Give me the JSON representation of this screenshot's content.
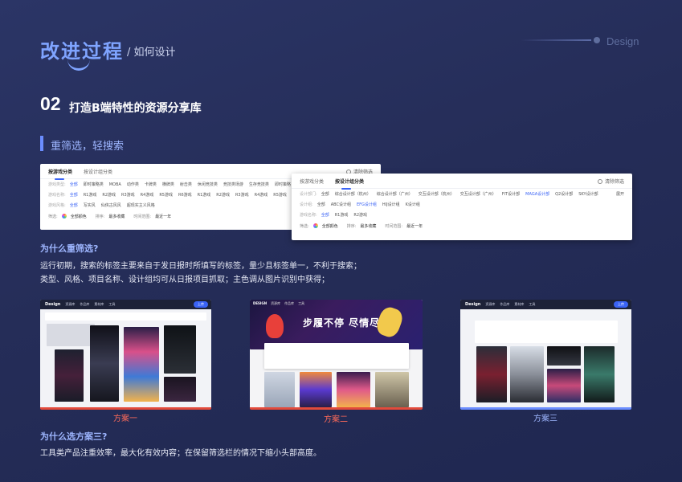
{
  "header": {
    "title": "改进过程",
    "subtitle": "/ 如何设计",
    "brand": "Design",
    "section_number": "02",
    "section_title": "打造B端特性的资源分享库",
    "sub_heading": "重筛选，轻搜索"
  },
  "panel1": {
    "tabs": [
      "按游戏分类",
      "按设计组分类"
    ],
    "active_tab": 0,
    "clear_label": "清除筛选",
    "rows": [
      {
        "label": "游戏类型:",
        "items": [
          "全部",
          "即时策略类",
          "MOBA",
          "动作类",
          "卡牌类",
          "横牌类",
          "射击类",
          "休闲竞技类",
          "竞技类场游",
          "生存竞技类",
          "即时策略"
        ],
        "selected": 0
      },
      {
        "label": "游戏名称:",
        "items": [
          "全部",
          "R1游戏",
          "R2游戏",
          "R3游戏",
          "R4游戏",
          "R5游戏",
          "R6游戏",
          "R1游戏",
          "R2游戏",
          "R3游戏",
          "R4游戏",
          "R5游戏"
        ],
        "selected": 0
      },
      {
        "label": "游戏风格:",
        "items": [
          "全部",
          "写实风",
          "仙侠古风风",
          "超现实主义风格"
        ],
        "selected": 0
      }
    ],
    "sort": {
      "filter_label": "筛选:",
      "color_label": "全部颜色",
      "sort_label": "排序:",
      "sort_value": "最多收藏",
      "time_label": "时间范围:",
      "time_value": "最近一年"
    }
  },
  "panel2": {
    "tabs": [
      "按游戏分类",
      "按设计组分类"
    ],
    "active_tab": 1,
    "clear_label": "清除筛选",
    "rows": [
      {
        "label": "设计部门:",
        "items": [
          "全部",
          "综合设计部（杭州）",
          "综合设计部（广州）",
          "交互设计部（杭州）",
          "交互设计部（广州）",
          "FIT设计部",
          "MAGA设计部",
          "Q2设计部",
          "SKY设计部"
        ],
        "selected": 6,
        "expand": "展开"
      },
      {
        "label": "设计组:",
        "items": [
          "全部",
          "ABC设计组",
          "EFG设计组",
          "HIJ设计组",
          "K设计组"
        ],
        "selected": 2
      },
      {
        "label": "游戏名称:",
        "items": [
          "全部",
          "R1游戏",
          "R2游戏"
        ],
        "selected": 0
      }
    ],
    "sort": {
      "filter_label": "筛选:",
      "color_label": "全部颜色",
      "sort_label": "排序:",
      "sort_value": "最多收藏",
      "time_label": "时间范围:",
      "time_value": "最近一年"
    }
  },
  "why_filter": {
    "question": "为什么重筛选?",
    "line1": "运行初期，搜索的标签主要来自于发日报时所填写的标签，量少且标签单一，不利于搜索；",
    "line2": "类型、风格、项目名称、设计组均可从日报项目抓取；主色调从图片识别中获得；"
  },
  "schemes": {
    "s1": {
      "logo": "Design",
      "nav": [
        "资源库",
        "作品库",
        "素材库",
        "工具"
      ],
      "button": "上传",
      "caption": "方案一"
    },
    "s2": {
      "logo": "DESIGN",
      "nav": [
        "资源库",
        "作品库",
        "工具"
      ],
      "banner": "步履不停 尽情尽兴",
      "caption": "方案二"
    },
    "s3": {
      "logo": "Design",
      "nav": [
        "资源库",
        "作品库",
        "素材库",
        "工具"
      ],
      "button": "上传",
      "caption": "方案三"
    }
  },
  "why_scheme": {
    "question": "为什么选方案三?",
    "text": "工具类产品注重效率，最大化有效内容；在保留筛选栏的情况下缩小头部高度。"
  },
  "colors": {
    "accent": "#7fa4ff",
    "highlight": "#3a63f5",
    "red": "#e24a3b",
    "bg": "#252d58"
  }
}
